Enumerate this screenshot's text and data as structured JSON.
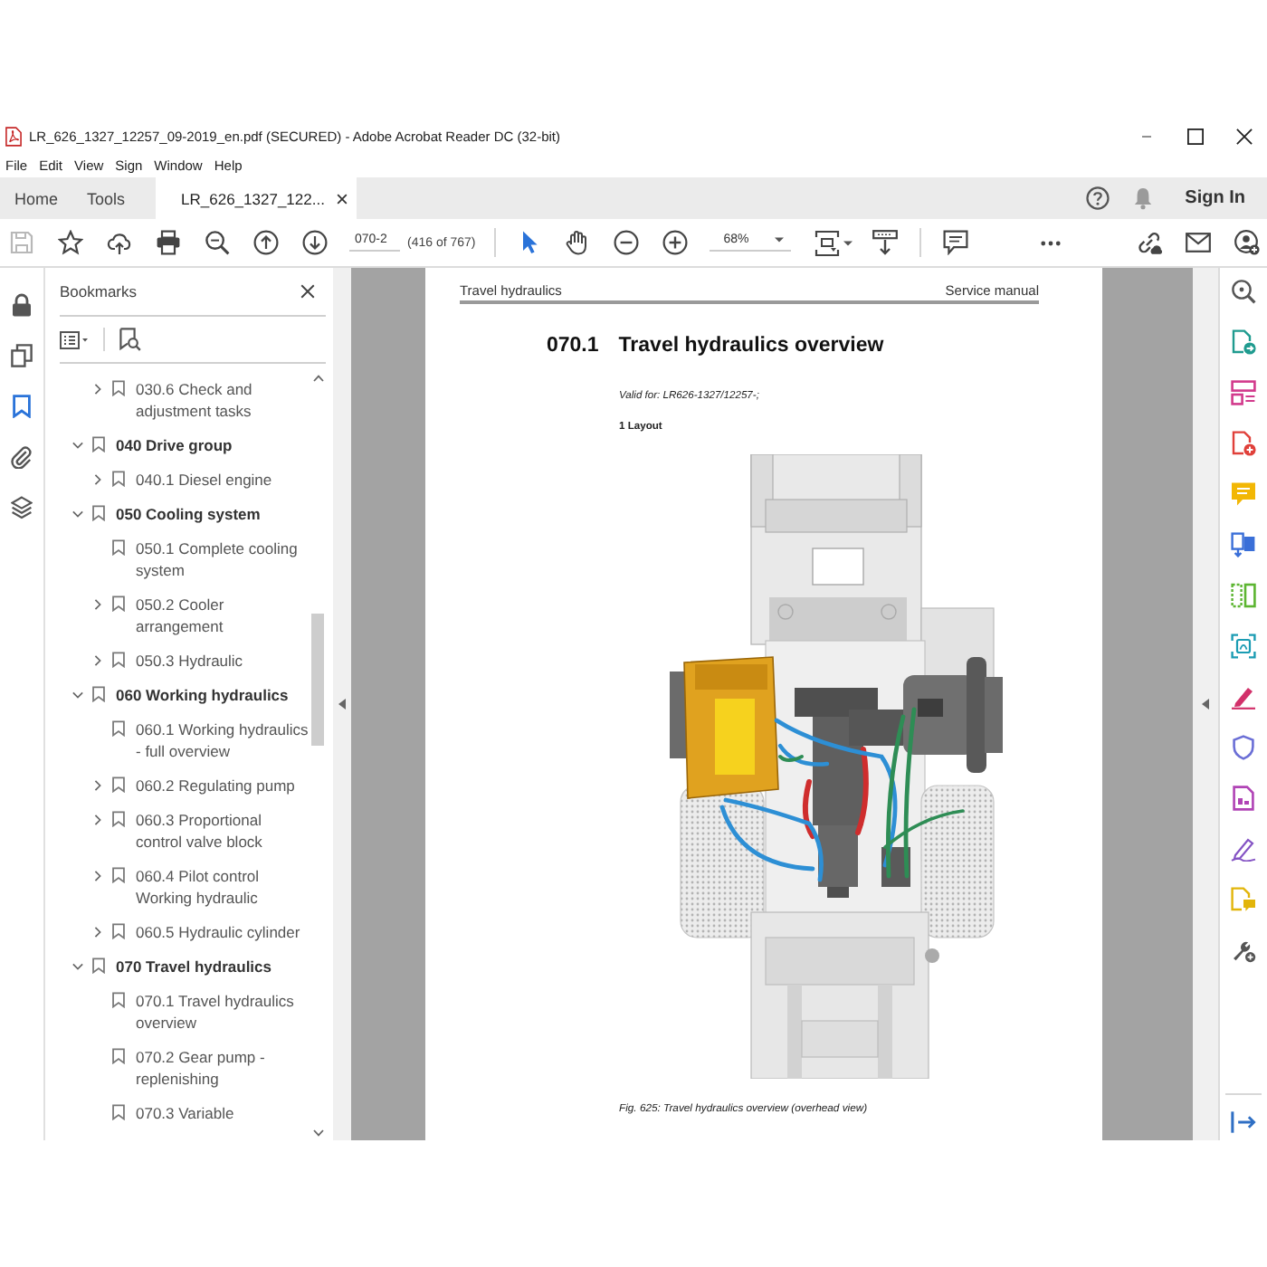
{
  "window": {
    "title": "LR_626_1327_12257_09-2019_en.pdf (SECURED) - Adobe Acrobat Reader DC (32-bit)"
  },
  "menu": [
    "File",
    "Edit",
    "View",
    "Sign",
    "Window",
    "Help"
  ],
  "tabs": [
    {
      "label": "Home",
      "kind": "nav",
      "selected": false
    },
    {
      "label": "Tools",
      "kind": "nav",
      "selected": false
    },
    {
      "label": "LR_626_1327_122...",
      "kind": "document",
      "selected": true
    }
  ],
  "account": {
    "sign_in": "Sign In"
  },
  "toolbar": {
    "save": {
      "disabled": true
    },
    "page": "070-2",
    "page_count": "(416 of 767)",
    "zoom": "68%",
    "tools": [
      {
        "kind": "select",
        "selected": true
      },
      {
        "kind": "hand",
        "selected": false
      }
    ]
  },
  "side_panels": [
    {
      "kind": "lock",
      "selected": false
    },
    {
      "kind": "pages",
      "selected": false
    },
    {
      "kind": "bookmarks",
      "selected": true
    },
    {
      "kind": "attachments",
      "selected": false
    },
    {
      "kind": "layers",
      "selected": false
    }
  ],
  "bookmarks": {
    "title": "Bookmarks",
    "items": [
      {
        "children": [
          {
            "label": "030.6 Check and adjustment tasks",
            "expanded": false
          }
        ]
      },
      {
        "label": "040 Drive group",
        "expanded": true,
        "children": [
          {
            "label": "040.1 Diesel engine",
            "expanded": false
          }
        ]
      },
      {
        "label": "050 Cooling system",
        "expanded": true,
        "children": [
          {
            "label": "050.1 Complete cooling system"
          },
          {
            "label": "050.2 Cooler arrangement",
            "expanded": false
          },
          {
            "label": "050.3 Hydraulic",
            "expanded": false
          }
        ]
      },
      {
        "label": "060 Working hydraulics",
        "expanded": true,
        "children": [
          {
            "label": "060.1 Working hydraulics - full overview"
          },
          {
            "label": "060.2 Regulating pump",
            "expanded": false
          },
          {
            "label": "060.3 Proportional control valve block",
            "expanded": false
          },
          {
            "label": "060.4 Pilot control Working hydraulic",
            "expanded": false
          },
          {
            "label": "060.5 Hydraulic cylinder",
            "expanded": false
          }
        ]
      },
      {
        "label": "070 Travel hydraulics",
        "expanded": true,
        "children": [
          {
            "label": "070.1 Travel hydraulics overview"
          },
          {
            "label": "070.2 Gear pump - replenishing"
          },
          {
            "label": "070.3 Variable"
          }
        ]
      }
    ]
  },
  "document": {
    "header_left": "Travel hydraulics",
    "header_right": "Service manual",
    "section_number": "070.1",
    "section_title": "Travel hydraulics overview",
    "valid_for": "Valid for: LR626-1327/12257-;",
    "subheading": "1 Layout",
    "caption": "Fig. 625: Travel hydraulics overview (overhead view)"
  }
}
